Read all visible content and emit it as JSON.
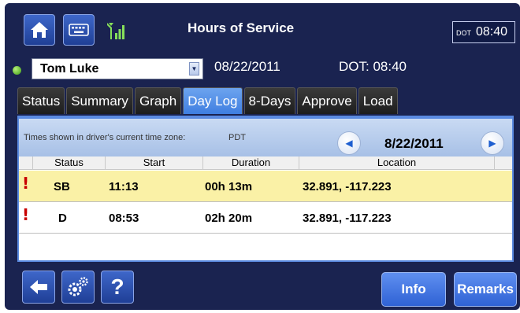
{
  "header": {
    "title": "Hours of Service",
    "dot_label": "DOT",
    "dot_clock": "08:40",
    "icons": [
      "home-icon",
      "keyboard-icon",
      "signal-icon"
    ]
  },
  "driver": {
    "name": "Tom Luke",
    "date": "08/22/2011",
    "dot_time": "DOT: 08:40",
    "status_color": "#4cb21e"
  },
  "tabs": [
    {
      "label": "Status"
    },
    {
      "label": "Summary"
    },
    {
      "label": "Graph"
    },
    {
      "label": "Day Log",
      "active": true
    },
    {
      "label": "8-Days"
    },
    {
      "label": "Approve"
    },
    {
      "label": "Load"
    }
  ],
  "daylog": {
    "tz_label": "Times shown in driver's current time zone:",
    "tz_value": "PDT",
    "current_date": "8/22/2011",
    "columns": {
      "status": "Status",
      "start": "Start",
      "duration": "Duration",
      "location": "Location"
    },
    "rows": [
      {
        "flag": "!",
        "status": "SB",
        "start": "11:13",
        "duration": "00h 13m",
        "location": "32.891, -117.223",
        "selected": true
      },
      {
        "flag": "!",
        "status": "D",
        "start": "08:53",
        "duration": "02h 20m",
        "location": "32.891, -117.223",
        "selected": false
      }
    ]
  },
  "footer": {
    "help_label": "?",
    "info_label": "Info",
    "remarks_label": "Remarks",
    "icons": [
      "back-arrow-icon",
      "settings-gears-icon",
      "help-icon"
    ]
  },
  "colors": {
    "frame": "#1a2350",
    "accent": "#3f7ee0",
    "selected_row": "#faf1a6",
    "alert": "#c80000"
  }
}
